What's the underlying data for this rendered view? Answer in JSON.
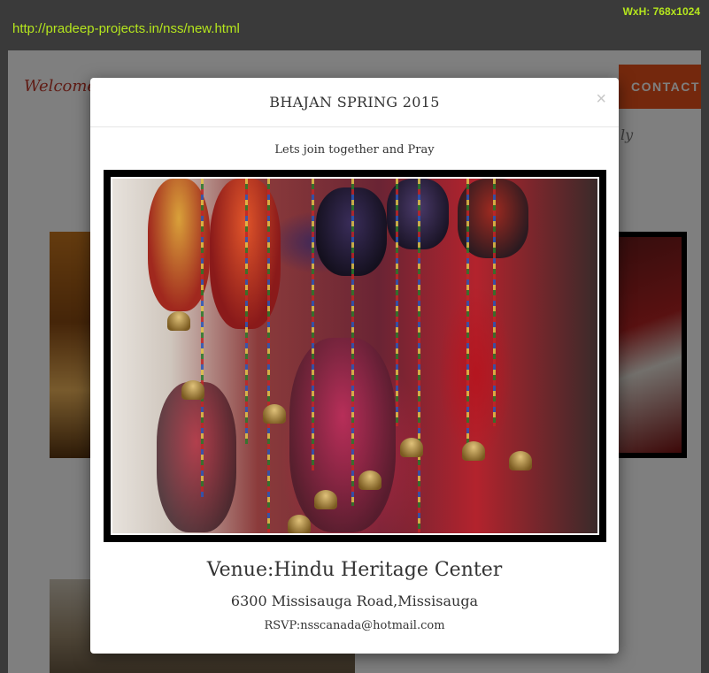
{
  "browser": {
    "url": "http://pradeep-projects.in/nss/new.html",
    "dimensions": "WxH: 768x1024"
  },
  "background_page": {
    "welcome_text": "Welcome",
    "nav_contact": "CONTACT",
    "partial_text": "ly"
  },
  "modal": {
    "title": "BHAJAN SPRING 2015",
    "close_symbol": "×",
    "subtitle": "Lets join together and Pray",
    "image_icon": "event-photo",
    "venue": "Venue:Hindu Heritage Center",
    "address": "6300 Missisauga Road,Missisauga",
    "rsvp": "RSVP:nsscanada@hotmail.com"
  },
  "colors": {
    "url_text": "#b5e61d",
    "contact_bg": "#e8501a",
    "welcome": "#c0392b"
  }
}
